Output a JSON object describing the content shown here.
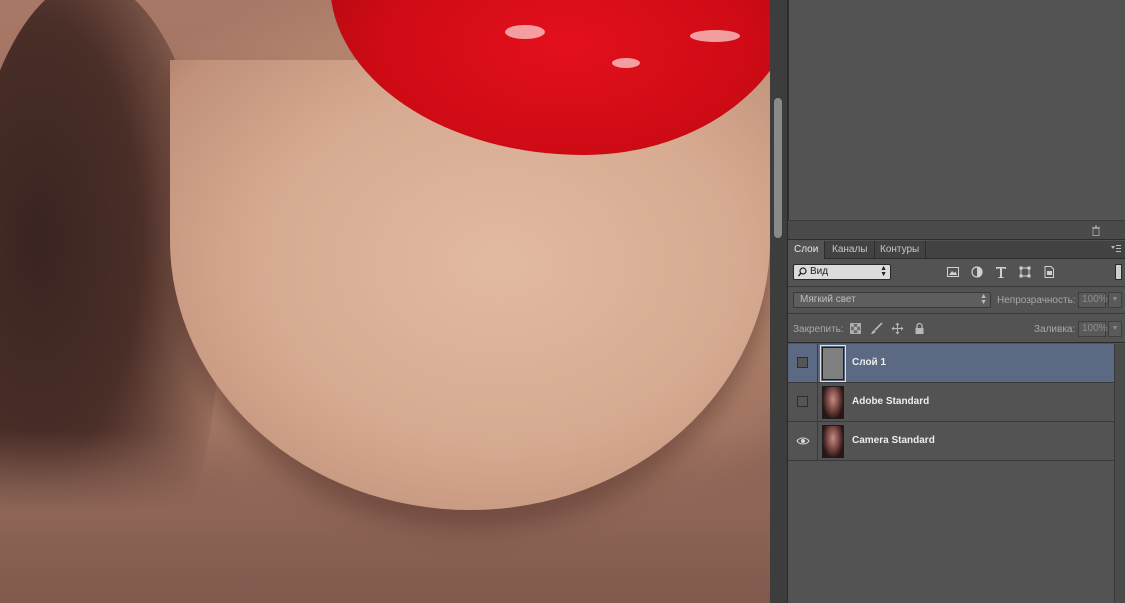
{
  "colors": {
    "panel_bg": "#535353",
    "selected_layer": "#5b6a82",
    "lips": "#d40c16",
    "skin": "#d8ae96"
  },
  "upper_panel": {
    "footer_icon": "trash-icon"
  },
  "tabs": [
    {
      "label": "Слои",
      "active": true
    },
    {
      "label": "Каналы",
      "active": false
    },
    {
      "label": "Контуры",
      "active": false
    }
  ],
  "filter": {
    "selected": "Вид",
    "icons": [
      "image-filter-icon",
      "adjustment-filter-icon",
      "type-filter-icon",
      "shape-filter-icon",
      "smart-object-filter-icon"
    ]
  },
  "blend": {
    "mode": "Мягкий свет",
    "opacity_label": "Непрозрачность:",
    "opacity_value": "100%"
  },
  "lock": {
    "label": "Закрепить:",
    "fill_label": "Заливка:",
    "fill_value": "100%"
  },
  "layers": [
    {
      "name": "Слой 1",
      "visible": false,
      "selected": true,
      "thumb": "gray"
    },
    {
      "name": "Adobe Standard",
      "visible": false,
      "selected": false,
      "thumb": "photo"
    },
    {
      "name": "Camera Standard",
      "visible": true,
      "selected": false,
      "thumb": "photo"
    }
  ]
}
